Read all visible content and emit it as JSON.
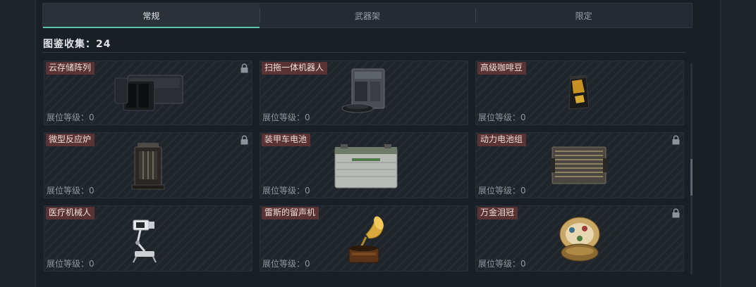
{
  "tabs": [
    {
      "label": "常规",
      "active": true
    },
    {
      "label": "武器架",
      "active": false
    },
    {
      "label": "限定",
      "active": false
    }
  ],
  "collection": {
    "text": "图鉴收集：24"
  },
  "items": [
    {
      "name": "云存储阵列",
      "level": "展位等级：0",
      "locked": true,
      "icon": "server-array-icon"
    },
    {
      "name": "扫拖一体机器人",
      "level": "展位等级：0",
      "locked": false,
      "icon": "robot-vacuum-icon"
    },
    {
      "name": "高级咖啡豆",
      "level": "展位等级：0",
      "locked": false,
      "icon": "coffee-bag-icon"
    },
    {
      "name": "微型反应炉",
      "level": "展位等级：0",
      "locked": true,
      "icon": "reactor-icon"
    },
    {
      "name": "装甲车电池",
      "level": "展位等级：0",
      "locked": false,
      "icon": "battery-icon"
    },
    {
      "name": "动力电池组",
      "level": "展位等级：0",
      "locked": true,
      "icon": "battery-pack-icon"
    },
    {
      "name": "医疗机械人",
      "level": "展位等级：0",
      "locked": false,
      "icon": "medical-robot-icon"
    },
    {
      "name": "雷斯的留声机",
      "level": "展位等级：0",
      "locked": false,
      "icon": "gramophone-icon"
    },
    {
      "name": "万金泪冠",
      "level": "展位等级：0",
      "locked": true,
      "icon": "jeweled-crown-icon"
    }
  ],
  "colors": {
    "accent": "#57c7a8",
    "tag_bg": "#5a3434"
  }
}
